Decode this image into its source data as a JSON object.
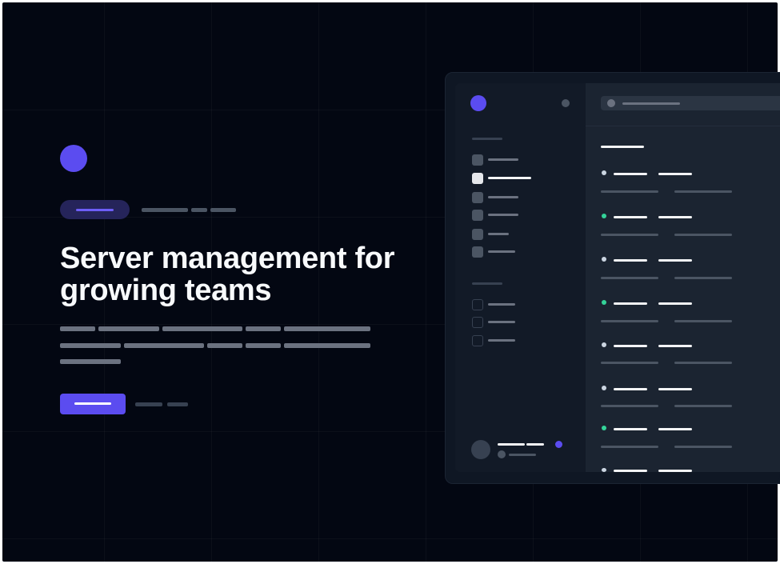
{
  "hero": {
    "headline": "Server management for growing teams"
  },
  "colors": {
    "accent": "#5b4cf0",
    "background": "#030712",
    "status_online": "#34d399",
    "status_idle": "#cbd5e1"
  },
  "sidebar": {
    "active_index": 1,
    "nav_count": 6,
    "secondary_count": 3
  },
  "server_rows": [
    {
      "status": "idle"
    },
    {
      "status": "online"
    },
    {
      "status": "idle"
    },
    {
      "status": "online"
    },
    {
      "status": "idle"
    },
    {
      "status": "idle"
    },
    {
      "status": "online"
    },
    {
      "status": "idle"
    }
  ]
}
